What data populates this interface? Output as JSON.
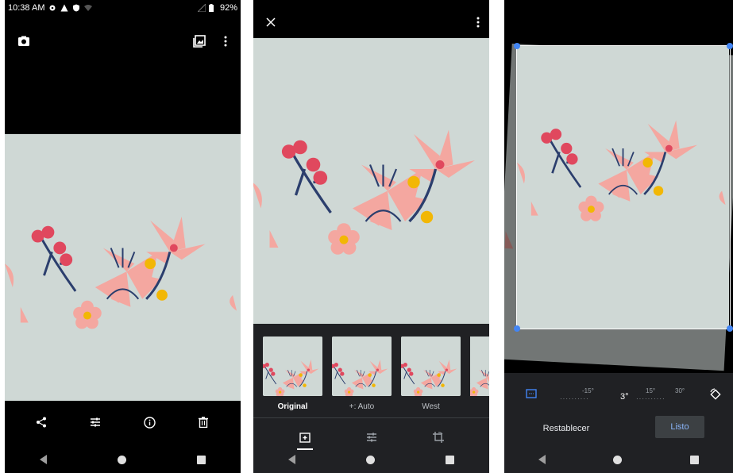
{
  "panel1": {
    "status": {
      "time": "10:38 AM",
      "battery": "92%"
    },
    "icons": {
      "camera": "camera-icon",
      "gallery": "gallery-icon",
      "more": "more-vert-icon",
      "share": "share-icon",
      "edit": "tune-icon",
      "info": "info-icon",
      "delete": "trash-icon"
    }
  },
  "panel2": {
    "filters": [
      {
        "label": "Original"
      },
      {
        "label": "+: Auto"
      },
      {
        "label": "West"
      }
    ],
    "icons": {
      "close": "close-icon",
      "more": "more-vert-icon",
      "suggestions": "auto-fix-icon",
      "adjust": "tune-icon",
      "crop": "crop-rotate-icon"
    }
  },
  "panel3": {
    "dial": {
      "m15": "-15°",
      "current": "3°",
      "p15": "15°",
      "p30": "30°"
    },
    "reset_label": "Restablecer",
    "done_label": "Listo",
    "icons": {
      "aspect": "aspect-ratio-icon",
      "rotate": "rotate-icon"
    }
  },
  "colors": {
    "background": "#000000",
    "tray": "#202124",
    "accent_blue": "#4285f4",
    "done_text": "#8ab4f8",
    "photo_bg": "#cdd7d4",
    "petal": "#f4a7a0",
    "berry": "#e0485e",
    "stem": "#2b3e6d",
    "yellow": "#f2b705"
  }
}
